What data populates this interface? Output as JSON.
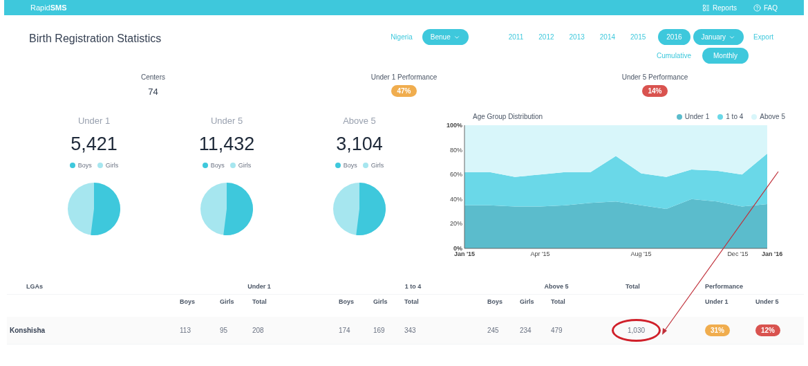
{
  "navbar": {
    "brand": "Rapid**SMS**",
    "items": [
      {
        "label": "Reports",
        "kind": "reports"
      },
      {
        "label": "FAQ",
        "kind": "faq"
      }
    ]
  },
  "page_title": "Birth Registration Statistics",
  "filters": {
    "country": "Nigeria",
    "state": "Benue",
    "years": [
      {
        "label": "2011",
        "selected": false
      },
      {
        "label": "2012",
        "selected": false
      },
      {
        "label": "2013",
        "selected": false
      },
      {
        "label": "2014",
        "selected": false
      },
      {
        "label": "2015",
        "selected": false
      },
      {
        "label": "2016",
        "selected": true
      }
    ],
    "month": "January",
    "export": "Export",
    "modes": [
      {
        "label": "Cumulative",
        "selected": false
      },
      {
        "label": "Monthly",
        "selected": true
      }
    ]
  },
  "summary": [
    {
      "label": "Centers",
      "value": "74",
      "kind": "number"
    },
    {
      "label": "Under 1 Performance",
      "value": "47%",
      "kind": "badge",
      "color": "#f0ad4e"
    },
    {
      "label": "Under 5 Performance",
      "value": "14%",
      "kind": "badge",
      "color": "#d9534f"
    }
  ],
  "groups": [
    {
      "title": "Under 1",
      "total": "5,421",
      "legend": [
        {
          "label": "Boys",
          "color": "#3ec8dc"
        },
        {
          "label": "Girls",
          "color": "#a6e6ef"
        }
      ]
    },
    {
      "title": "Under 5",
      "total": "11,432",
      "legend": [
        {
          "label": "Boys",
          "color": "#3ec8dc"
        },
        {
          "label": "Girls",
          "color": "#a6e6ef"
        }
      ]
    },
    {
      "title": "Above 5",
      "total": "3,104",
      "legend": [
        {
          "label": "Boys",
          "color": "#3ec8dc"
        },
        {
          "label": "Girls",
          "color": "#a6e6ef"
        }
      ]
    }
  ],
  "chart": {
    "chart_data": {
      "type": "area",
      "title": "Age Group Distribution",
      "stacked": true,
      "legend": true,
      "categories": [
        "Jan '15",
        null,
        null,
        "Apr '15",
        null,
        null,
        null,
        "Aug '15",
        null,
        null,
        null,
        "Dec '15",
        "Jan '16"
      ],
      "series": [
        {
          "name": "Under 1",
          "color": "#5bbccc",
          "values": [
            35,
            35,
            34,
            34,
            35,
            37,
            38,
            35,
            32,
            40,
            38,
            34,
            36
          ]
        },
        {
          "name": "1 to 4",
          "color": "#6ad8e8",
          "values": [
            27,
            27,
            24,
            26,
            27,
            25,
            37,
            26,
            26,
            24,
            25,
            26,
            41
          ]
        },
        {
          "name": "Above 5",
          "color": "#d8f6fa",
          "values": [
            38,
            38,
            42,
            40,
            38,
            38,
            25,
            39,
            42,
            36,
            37,
            40,
            23
          ]
        }
      ],
      "ylim": [
        0,
        100
      ],
      "yticks": [
        {
          "value": 0,
          "label": "0%"
        },
        {
          "value": 20,
          "label": "20%"
        },
        {
          "value": 40,
          "label": "40%"
        },
        {
          "value": 60,
          "label": "60%"
        },
        {
          "value": 80,
          "label": "80%"
        },
        {
          "value": 100,
          "label": "100%"
        }
      ]
    }
  },
  "table": {
    "lga_header": "LGAs",
    "groups": [
      {
        "title": "Under 1",
        "columns": [
          "Boys",
          "Girls",
          "Total"
        ]
      },
      {
        "title": "1 to 4",
        "columns": [
          "Boys",
          "Girls",
          "Total"
        ]
      },
      {
        "title": "Above 5",
        "columns": [
          "Boys",
          "Girls",
          "Total"
        ]
      }
    ],
    "total_header": "Total",
    "performance": {
      "title": "Performance",
      "columns": [
        "Under 1",
        "Under 5"
      ]
    },
    "rows": [
      {
        "lga": "Konshisha",
        "values": [
          "113",
          "95",
          "208",
          "174",
          "169",
          "343",
          "245",
          "234",
          "479"
        ],
        "total": "1,030",
        "highlighted": true,
        "badges": [
          {
            "value": "31%",
            "color": "#f0ad4e"
          },
          {
            "value": "12%",
            "color": "#d9534f"
          }
        ]
      }
    ]
  }
}
